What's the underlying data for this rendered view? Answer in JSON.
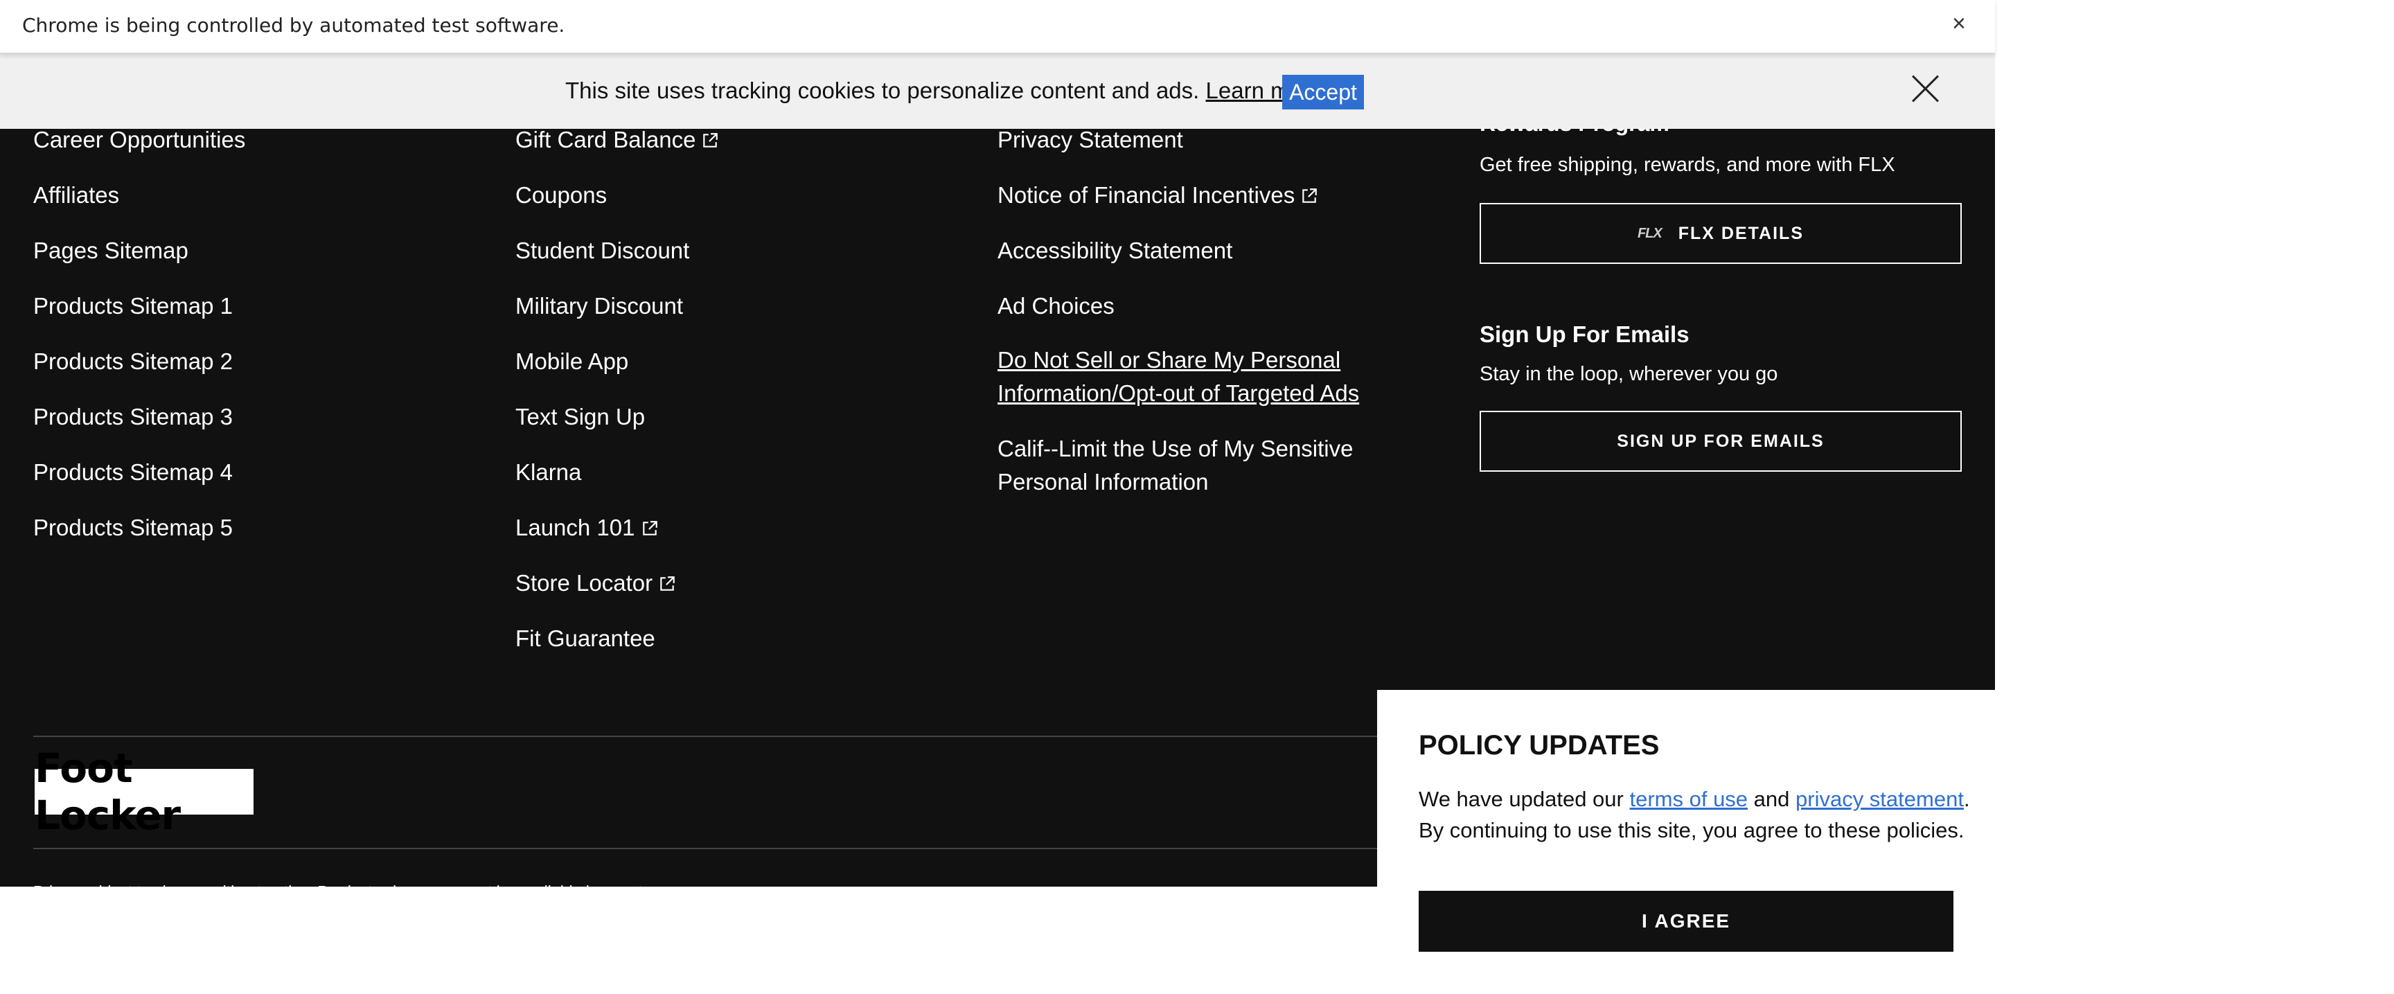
{
  "browser": {
    "automation_notice": "Chrome is being controlled by automated test software.",
    "close_symbol": "×"
  },
  "cookie_banner": {
    "text": "This site uses tracking cookies to personalize content and ads.",
    "learn_more": "Learn more",
    "accept": "Accept"
  },
  "footer": {
    "column1": [
      "Career Opportunities",
      "Affiliates",
      "Pages Sitemap",
      "Products Sitemap 1",
      "Products Sitemap 2",
      "Products Sitemap 3",
      "Products Sitemap 4",
      "Products Sitemap 5"
    ],
    "column2": [
      {
        "label": "Gift Card Balance",
        "icon": "external-link-icon"
      },
      {
        "label": "Coupons"
      },
      {
        "label": "Student Discount"
      },
      {
        "label": "Military Discount"
      },
      {
        "label": "Mobile App"
      },
      {
        "label": "Text Sign Up"
      },
      {
        "label": "Klarna"
      },
      {
        "label": "Launch 101",
        "icon": "external-link-icon"
      },
      {
        "label": "Store Locator",
        "icon": "external-link-icon"
      },
      {
        "label": "Fit Guarantee"
      }
    ],
    "column3": [
      {
        "label": "Privacy Statement"
      },
      {
        "label": "Notice of Financial Incentives",
        "icon": "external-link-icon"
      },
      {
        "label": "Accessibility Statement"
      },
      {
        "label": "Ad Choices"
      },
      {
        "label": "Do Not Sell or Share My Personal Information/Opt-out of Targeted Ads"
      },
      {
        "label": "Calif--Limit the Use of My Sensitive Personal Information"
      }
    ],
    "rewards": {
      "heading": "Rewards Program",
      "subtext": "Get free shipping, rewards, and more with FLX",
      "flx_logo": "FLX",
      "flx_button": "FLX DETAILS"
    },
    "emails": {
      "heading": "Sign Up For Emails",
      "subtext": "Stay in the loop, wherever you go",
      "button": "SIGN UP FOR EMAILS"
    },
    "logo": "Foot Locker",
    "disclaimer": "Prices subject to change without notice. Products shown may not be available in our stores."
  },
  "policy_modal": {
    "title": "POLICY UPDATES",
    "text_before": "We have updated our ",
    "terms_link": "terms of use",
    "text_middle": " and ",
    "privacy_link": "privacy statement",
    "text_after": ". By continuing to use this site, you agree to these policies.",
    "button": "I AGREE"
  }
}
